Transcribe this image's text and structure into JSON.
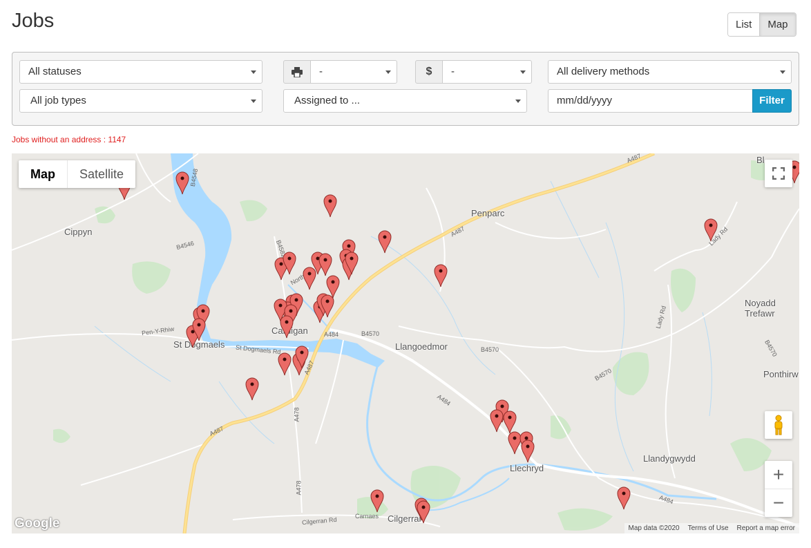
{
  "page": {
    "title": "Jobs"
  },
  "view_toggle": {
    "list_label": "List",
    "map_label": "Map",
    "active": "Map"
  },
  "filters": {
    "status": {
      "value": "All statuses"
    },
    "printer": {
      "icon": "printer-icon",
      "value": "-"
    },
    "price": {
      "icon_glyph": "$",
      "icon": "dollar-icon",
      "value": "-"
    },
    "delivery": {
      "value": "All delivery methods"
    },
    "job_type": {
      "value": "All job types"
    },
    "assigned": {
      "value": "Assigned to ..."
    },
    "date": {
      "placeholder": "mm/dd/yyyy"
    },
    "filter_button": "Filter"
  },
  "notice": {
    "text": "Jobs without an address : 1147"
  },
  "map": {
    "type_map": "Map",
    "type_satellite": "Satellite",
    "active_type": "Map",
    "places": {
      "cippyn": "Cippyn",
      "penparc": "Penparc",
      "st_dogmaels": "St Dogmaels",
      "cardigan": "Cardigan",
      "llangoedmor": "Llangoedmor",
      "noyadd": "Noyadd",
      "trefawr": "Trefawr",
      "ponthirw": "Ponthirw",
      "llechryd": "Llechryd",
      "llandygwydd": "Llandygwydd",
      "cilgerran": "Cilgerran",
      "blaenporth": "Bl"
    },
    "roads": {
      "a487_n": "A487",
      "a487_mid": "A487",
      "a487_sw": "A487",
      "a487_c": "A487",
      "a484_a": "A484",
      "a484_b": "A484",
      "a484_c": "A484",
      "b4570_a": "B4570",
      "b4570_b": "B4570",
      "b4570_c": "B4570",
      "b4570_d": "B4570",
      "b4548": "B4548",
      "b4546": "B4546",
      "b4582": "B4582",
      "a478_a": "A478",
      "a478_b": "A478",
      "pen_y_rhiw": "Pen-Y-Rhiw",
      "st_dogmaels_rd": "St Dogmaels Rd",
      "lady_rd_a": "Lady Rd",
      "lady_rd_b": "Lady Rd",
      "cilgerran_rd": "Cilgerran Rd",
      "carnaes": "Carnaes",
      "north_rd": "North Rd"
    },
    "zoom_in": "+",
    "zoom_out": "−",
    "logo": "Google",
    "attribution": {
      "data": "Map data ©2020",
      "terms": "Terms of Use",
      "report": "Report a map error"
    },
    "pin_color": "#ea6b66"
  }
}
